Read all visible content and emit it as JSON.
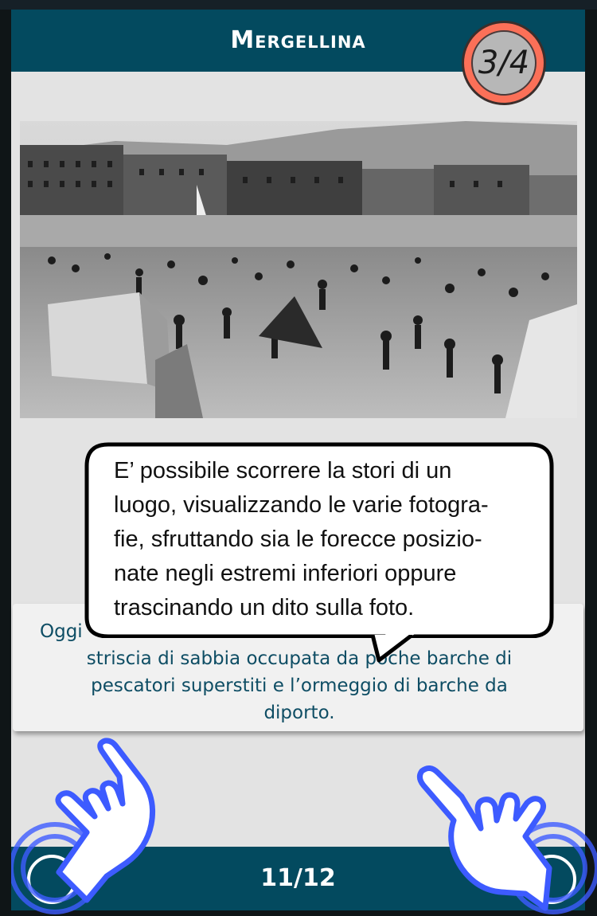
{
  "header": {
    "title": "Mergellina",
    "page_indicator": "3/4"
  },
  "photo": {
    "icon": "historic-beach-photo"
  },
  "tooltip": {
    "lines": [
      "E’ possibile scorrere la stori di un",
      "luogo, visualizzando le varie fotogra-",
      "fie, sfruttando sia le forecce posizio-",
      "nate negli estremi inferiori oppure",
      "trascinando un dito sulla foto."
    ]
  },
  "caption": {
    "visible_lines": [
      "Oggi",
      "striscia di sabbia occupata da poche barche di",
      "pescatori superstiti e l’ormeggio di barche da",
      "diporto."
    ]
  },
  "footer": {
    "counter": "11/12"
  },
  "colors": {
    "header_bg": "#034a5f",
    "badge_ring": "#fb7058",
    "hand_blue": "#3d5bff",
    "caption_text": "#0e4d64"
  },
  "icons": {
    "left_hand": "pointing-hand-icon",
    "right_hand": "pointing-hand-icon",
    "prev": "prev-arrow-icon",
    "next": "next-arrow-icon"
  }
}
